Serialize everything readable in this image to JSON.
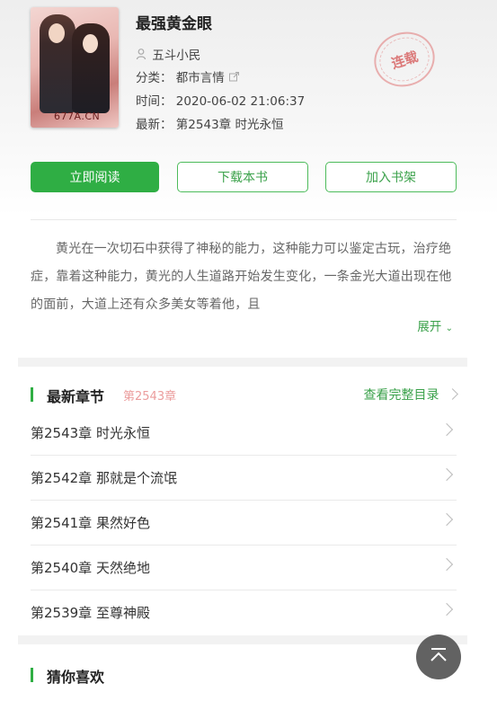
{
  "book": {
    "title": "最强黄金眼",
    "author": "五斗小民",
    "category_label": "分类：",
    "category": "都市言情",
    "time_label": "时间：",
    "time": "2020-06-02 21:06:37",
    "latest_label": "最新：",
    "latest": "第2543章 时光永恒",
    "cover_tag": "677A.CN",
    "status_stamp": "连载"
  },
  "actions": {
    "read": "立即阅读",
    "download": "下载本书",
    "shelf": "加入书架"
  },
  "intro": {
    "text": "黄光在一次切石中获得了神秘的能力，这种能力可以鉴定古玩，治疗绝症，靠着这种能力，黄光的人生道路开始发生变化，一条金光大道出现在他的面前，大道上还有众多美女等着他，且",
    "expand": "展开"
  },
  "latest_chapters": {
    "title": "最新章节",
    "subtitle": "第2543章",
    "more": "查看完整目录",
    "items": [
      "第2543章 时光永恒",
      "第2542章 那就是个流氓",
      "第2541章 果然好色",
      "第2540章 天然绝地",
      "第2539章 至尊神殿"
    ]
  },
  "recommend": {
    "title": "猜你喜欢"
  },
  "colors": {
    "accent": "#2fae44",
    "link": "#3aa14a"
  }
}
